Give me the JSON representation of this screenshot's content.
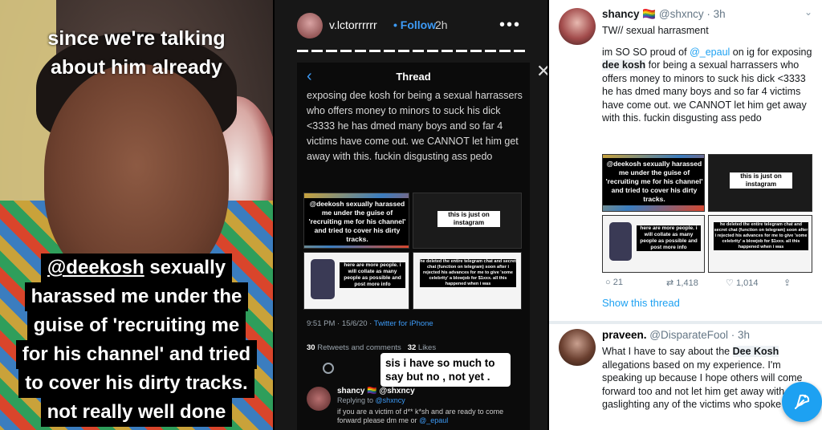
{
  "panel1": {
    "caption_top": [
      "since we're talking",
      "about him already"
    ],
    "caption_box": {
      "handle": "@deekosh",
      "line1_rest": " sexually",
      "lines": [
        "harassed me under the",
        "guise of 'recruiting me",
        "for his channel' and tried",
        "to cover his dirty tracks.",
        "not really well done"
      ]
    }
  },
  "panel2": {
    "username": "v.lctorrrrrr",
    "follow": "• Follow",
    "age": "2h",
    "more": "•••",
    "close": "✕",
    "thread_title": "Thread",
    "tweet_text": "exposing dee kosh for being a sexual harrassers who offers money to minors to suck his dick <3333 he has dmed many boys and so far 4 victims have come out. we CANNOT let him get away with this. fuckin disgusting ass pedo",
    "image_tags": {
      "tl": "@deekosh sexually harassed me under the guise of 'recruiting me for his channel' and tried to cover his dirty tracks.",
      "tr": "this is just on instagram",
      "bl": "here are more people. i will collate as many people as possible and post more info",
      "br": "he deleted the entire telegram chat and secret chat (function on telegram) soon after i rejected his advances for me to give 'some celebrity' a blowjob for $1xxx. all this happened when i was"
    },
    "meta_time": "9:51 PM · 15/6/20 ·",
    "meta_source": "Twitter for iPhone",
    "stats_retweets": "30",
    "stats_retweets_label": "Retweets and comments",
    "stats_likes": "32",
    "stats_likes_label": "Likes",
    "sticker": "sis i have so much to say but no , not yet .",
    "reply_name": "shancy 🏳‍🌈 @shxncy",
    "reply_to_label": "Replying to",
    "reply_to_handle": "@shxncy",
    "reply_text": "if you are a victim of d** k*sh and are ready to come forward please dm me or",
    "reply_mention": "@_epaul"
  },
  "panel3": {
    "tweet1": {
      "name": "shancy 🏳‍🌈",
      "handle": "@shxncy · 3h",
      "line1": "TW// sexual harrasment",
      "p_start": "im SO SO proud of ",
      "mention": "@_epaul",
      "p_mid": " on ig for exposing ",
      "highlight": "dee kosh",
      "p_end": " for being a sexual harrassers who offers money to minors to suck his dick <3333 he has dmed many boys and so far 4 victims have come out. we CANNOT let him get away with this. fuckin disgusting ass pedo",
      "replies": "21",
      "retweets": "1,418",
      "likes": "1,014",
      "show_thread": "Show this thread"
    },
    "tweet2": {
      "name": "praveen.",
      "handle": "@DisparateFool · 3h",
      "t_start": "What I have to say about the ",
      "highlight": "Dee Kosh",
      "t_end": " allegations based on my experience. I'm speaking up because I hope others will come forward too and not let him get away with gaslighting any of the victims who spoke up."
    },
    "chevron": "⌄"
  },
  "colors": {
    "twitter_blue": "#1da1f2",
    "instagram_blue": "#3d9bf7"
  }
}
